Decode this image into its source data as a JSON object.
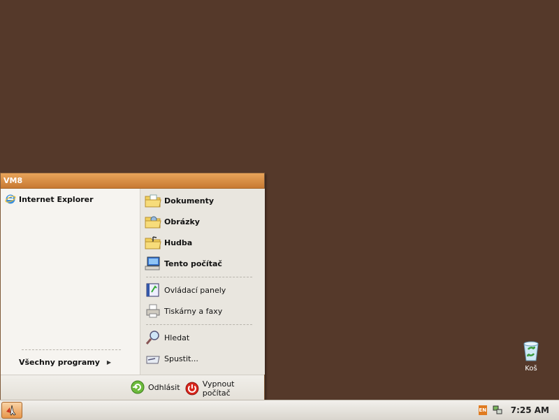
{
  "start_menu": {
    "user_name": "VM8",
    "pinned": [
      {
        "label": "Internet Explorer",
        "icon": "internet-explorer-icon"
      }
    ],
    "all_programs_label": "Všechny programy",
    "right_items": [
      {
        "label": "Dokumenty",
        "icon": "folder-documents-icon",
        "bold": true
      },
      {
        "label": "Obrázky",
        "icon": "folder-pictures-icon",
        "bold": true
      },
      {
        "label": "Hudba",
        "icon": "folder-music-icon",
        "bold": true
      },
      {
        "label": "Tento počítač",
        "icon": "my-computer-icon",
        "bold": true
      },
      {
        "label": "Ovládací panely",
        "icon": "control-panel-icon",
        "bold": false
      },
      {
        "label": "Tiskárny a faxy",
        "icon": "printer-icon",
        "bold": false
      },
      {
        "label": "Hledat",
        "icon": "search-icon",
        "bold": false
      },
      {
        "label": "Spustit...",
        "icon": "run-icon",
        "bold": false
      }
    ],
    "logoff_label": "Odhlásit",
    "shutdown_label": "Vypnout počítač"
  },
  "desktop": {
    "icons": [
      {
        "label": "Koš",
        "icon": "recycle-bin-icon"
      }
    ]
  },
  "taskbar": {
    "language": "EN",
    "clock": "7:25 AM"
  },
  "colors": {
    "desktop_bg": "#55392a",
    "menu_header": "#d98a40",
    "accent_orange": "#e07b20"
  }
}
